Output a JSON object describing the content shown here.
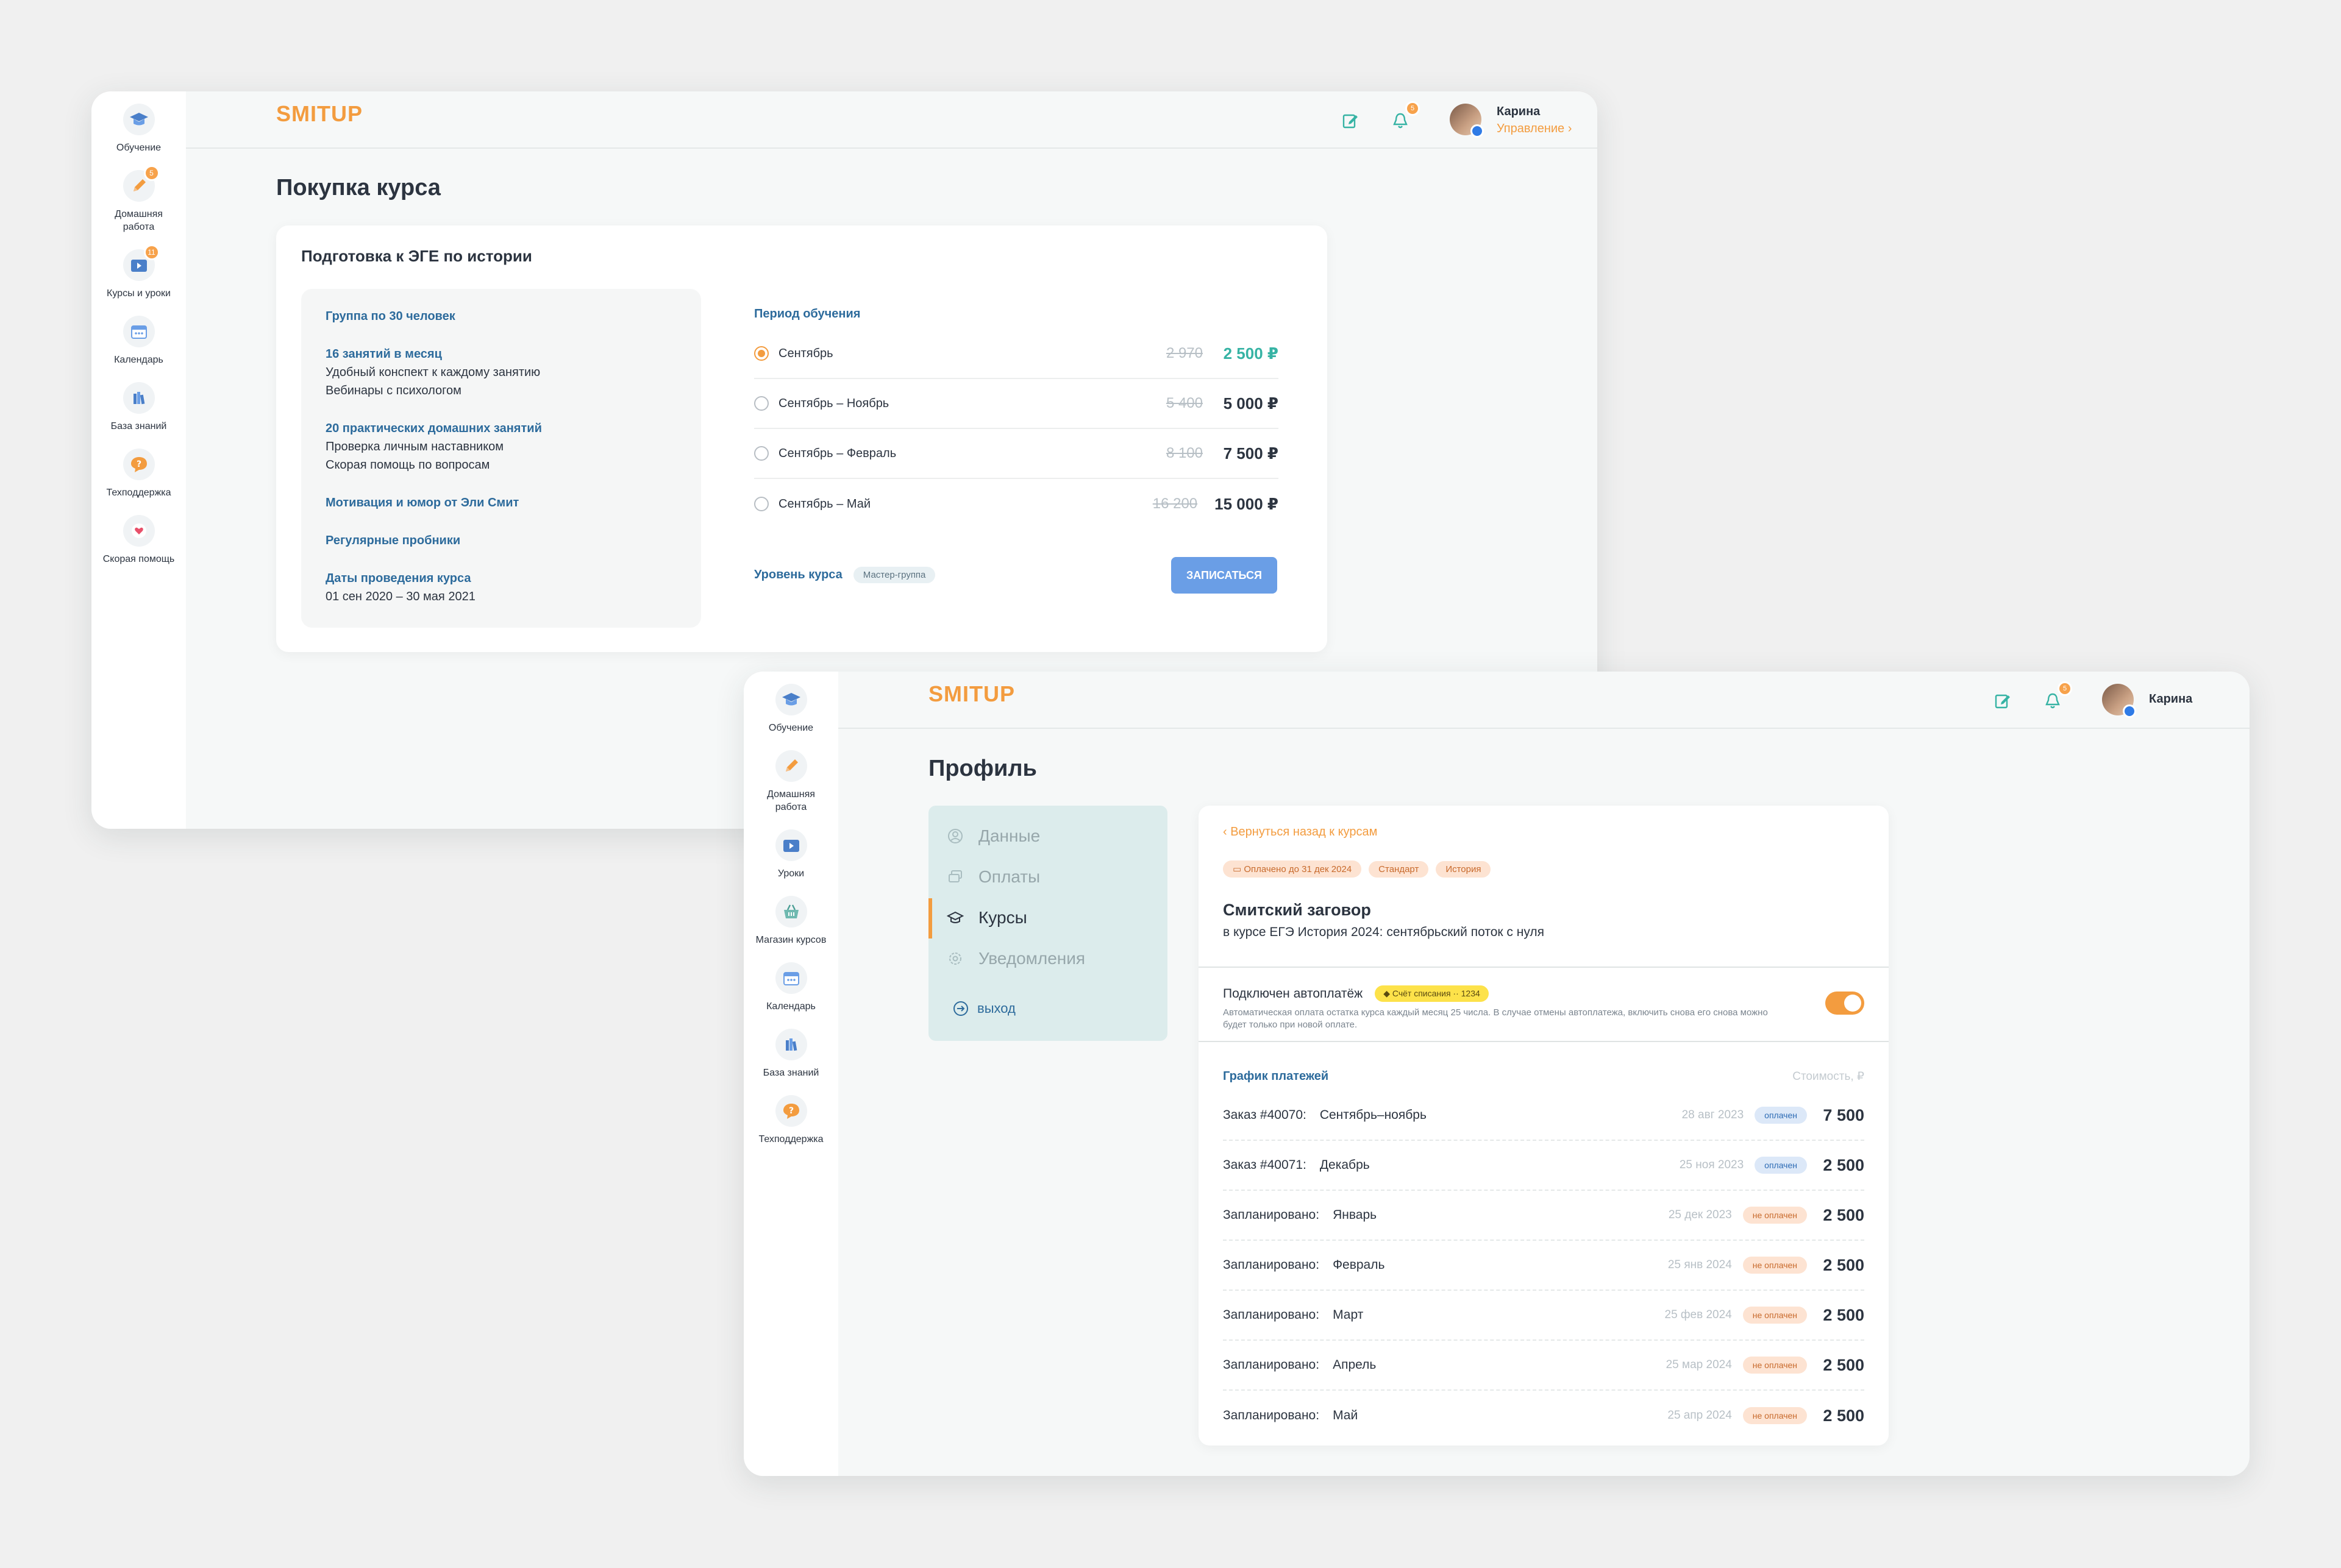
{
  "window1": {
    "sidebar": [
      {
        "label": "Обучение",
        "icon": "graduation-cap-icon"
      },
      {
        "label": "Домашняя работа",
        "icon": "pencil-icon",
        "badge": "5"
      },
      {
        "label": "Курсы и уроки",
        "icon": "video-lesson-icon",
        "badge": "11"
      },
      {
        "label": "Календарь",
        "icon": "calendar-icon"
      },
      {
        "label": "База знаний",
        "icon": "books-icon"
      },
      {
        "label": "Техподдержка",
        "icon": "question-icon"
      },
      {
        "label": "Скорая помощь",
        "icon": "heart-icon"
      }
    ],
    "logo": "SMITUP",
    "notifications_badge": "5",
    "user": {
      "name": "Карина",
      "manage": "Управление"
    },
    "page_title": "Покупка курса",
    "course": {
      "title": "Подготовка к ЭГЕ по истории",
      "features": {
        "group": "Группа по 30 человек",
        "lessons_title": "16 занятий в месяц",
        "lessons_items": [
          "Удобный конспект к каждому занятию",
          "Вебинары с психологом"
        ],
        "homework_title": "20 практических домашних занятий",
        "homework_items": [
          "Проверка личным наставником",
          "Скорая помощь по вопросам"
        ],
        "motivation": "Мотивация и юмор от Эли Смит",
        "mocks": "Регулярные пробники",
        "dates_title": "Даты проведения курса",
        "dates": "01 сен 2020 – 30 мая 2021"
      },
      "period_title": "Период обучения",
      "periods": [
        {
          "name": "Сентябрь",
          "old": "2 970",
          "price": "2 500 ₽",
          "selected": true
        },
        {
          "name": "Сентябрь – Ноябрь",
          "old": "5 400",
          "price": "5 000 ₽",
          "selected": false
        },
        {
          "name": "Сентябрь – Февраль",
          "old": "8 100",
          "price": "7 500 ₽",
          "selected": false
        },
        {
          "name": "Сентябрь – Май",
          "old": "16 200",
          "price": "15 000 ₽",
          "selected": false
        }
      ],
      "level_label": "Уровень курса",
      "level": "Мастер-группа",
      "enroll": "ЗАПИСАТЬСЯ"
    }
  },
  "window2": {
    "sidebar": [
      {
        "label": "Обучение",
        "icon": "graduation-cap-icon"
      },
      {
        "label": "Домашняя работа",
        "icon": "pencil-icon"
      },
      {
        "label": "Уроки",
        "icon": "video-lesson-icon"
      },
      {
        "label": "Магазин курсов",
        "icon": "basket-icon"
      },
      {
        "label": "Календарь",
        "icon": "calendar-icon"
      },
      {
        "label": "База знаний",
        "icon": "books-icon"
      },
      {
        "label": "Техподдержка",
        "icon": "question-icon"
      }
    ],
    "logo": "SMITUP",
    "notifications_badge": "5",
    "user": {
      "name": "Карина"
    },
    "page_title": "Профиль",
    "menu": [
      {
        "label": "Данные",
        "icon": "user-icon",
        "active": false
      },
      {
        "label": "Оплаты",
        "icon": "cards-icon",
        "active": false
      },
      {
        "label": "Курсы",
        "icon": "graduation-cap-icon",
        "active": true
      },
      {
        "label": "Уведомления",
        "icon": "bell-gear-icon",
        "active": false
      }
    ],
    "logout": "выход",
    "detail": {
      "back": "Вернуться назад к курсам",
      "chips": [
        "Оплачено до 31 дек 2024",
        "Стандарт",
        "История"
      ],
      "course_title": "Смитский заговор",
      "course_subtitle": "в курсе ЕГЭ История 2024: сентябрьский поток с нуля",
      "autopay_label": "Подключен автоплатёж",
      "autopay_card": "Счёт списания ·· 1234",
      "autopay_note": "Автоматическая оплата остатка курса каждый месяц 25 числа. В случае отмены автоплатежа, включить снова его снова можно будет только при новой оплате.",
      "schedule_title": "График платежей",
      "schedule_cost": "Стоимость, ₽",
      "payments": [
        {
          "label": "Заказ #40070:",
          "month": "Сентябрь–ноябрь",
          "date": "28 авг 2023",
          "status": "оплачен",
          "paid": true,
          "amount": "7 500"
        },
        {
          "label": "Заказ #40071:",
          "month": "Декабрь",
          "date": "25 ноя 2023",
          "status": "оплачен",
          "paid": true,
          "amount": "2 500"
        },
        {
          "label": "Запланировано:",
          "month": "Январь",
          "date": "25 дек 2023",
          "status": "не оплачен",
          "paid": false,
          "amount": "2 500"
        },
        {
          "label": "Запланировано:",
          "month": "Февраль",
          "date": "25 янв 2024",
          "status": "не оплачен",
          "paid": false,
          "amount": "2 500"
        },
        {
          "label": "Запланировано:",
          "month": "Март",
          "date": "25 фев 2024",
          "status": "не оплачен",
          "paid": false,
          "amount": "2 500"
        },
        {
          "label": "Запланировано:",
          "month": "Апрель",
          "date": "25 мар 2024",
          "status": "не оплачен",
          "paid": false,
          "amount": "2 500"
        },
        {
          "label": "Запланировано:",
          "month": "Май",
          "date": "25 апр 2024",
          "status": "не оплачен",
          "paid": false,
          "amount": "2 500"
        }
      ]
    }
  },
  "colors": {
    "accent": "#f39c3f",
    "teal": "#36b3a4",
    "blue_button": "#6a9ee6",
    "heading_blue": "#2d6b9c"
  }
}
